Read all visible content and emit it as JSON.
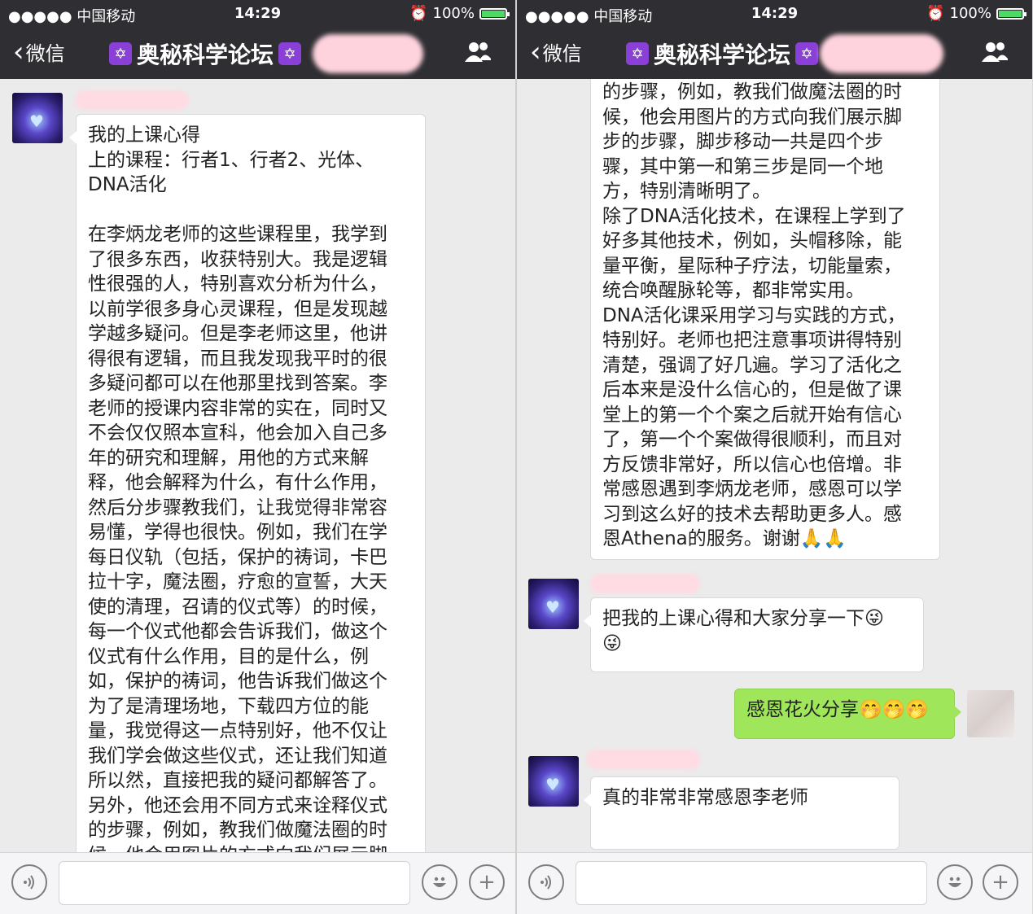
{
  "status": {
    "carrier": "●●●●● 中国移动",
    "time": "14:29",
    "battery": "100%",
    "battery_level": 1.0
  },
  "nav": {
    "back_label": "微信",
    "title": "奥秘科学论坛",
    "title_badge_icon": "star-of-david-icon",
    "members_icon": "people-icon"
  },
  "left_screen": {
    "message": "我的上课心得\n上的课程：行者1、行者2、光体、\nDNA活化\n\n在李炳龙老师的这些课程里，我学到\n了很多东西，收获特别大。我是逻辑\n性很强的人，特别喜欢分析为什么，\n以前学很多身心灵课程，但是发现越\n学越多疑问。但是李老师这里，他讲\n得很有逻辑，而且我发现我平时的很\n多疑问都可以在他那里找到答案。李\n老师的授课内容非常的实在，同时又\n不会仅仅照本宣科，他会加入自己多\n年的研究和理解，用他的方式来解\n释，他会解释为什么，有什么作用，\n然后分步骤教我们，让我觉得非常容\n易懂，学得也很快。例如，我们在学\n每日仪轨（包括，保护的祷词，卡巴\n拉十字，魔法圈，疗愈的宣誓，大天\n使的清理，召请的仪式等）的时候，\n每一个仪式他都会告诉我们，做这个\n仪式有什么作用，目的是什么，例\n如，保护的祷词，他告诉我们做这个\n为了是清理场地，下载四方位的能\n量，我觉得这一点特别好，他不仅让\n我们学会做这些仪式，还让我们知道\n所以然，直接把我的疑问都解答了。\n另外，他还会用不同方式来诠释仪式\n的步骤，例如，教我们做魔法圈的时\n候，他会用图片的方式向我们展示脚"
  },
  "right_screen": {
    "message_continued": "的步骤，例如，教我们做魔法圈的时\n候，他会用图片的方式向我们展示脚\n步的步骤，脚步移动一共是四个步\n骤，其中第一和第三步是同一个地\n方，特别清晰明了。\n除了DNA活化技术，在课程上学到了\n好多其他技术，例如，头帽移除，能\n量平衡，星际种子疗法，切能量索，\n统合唤醒脉轮等，都非常实用。\nDNA活化课采用学习与实践的方式，\n特别好。老师也把注意事项讲得特别\n清楚，强调了好几遍。学习了活化之\n后本来是没什么信心的，但是做了课\n堂上的第一个个案之后就开始有信心\n了，第一个个案做得很顺利，而且对\n方反馈非常好，所以信心也倍增。非\n常感恩遇到李炳龙老师，感恩可以学\n习到这么好的技术去帮助更多人。感\n恩Athena的服务。谢谢🙏🙏",
    "msg_share_request": "把我的上课心得和大家分享一下😜\n😜",
    "msg_reply_me": "感恩花火分享🤭🤭🤭",
    "msg_thanks": "真的非常非常感恩李老师"
  },
  "input": {
    "voice_icon": "voice-icon",
    "emoji_icon": "emoji-icon",
    "plus_icon": "plus-icon"
  },
  "colors": {
    "bar_bg": "#2f2f33",
    "chat_bg": "#ebebeb",
    "bubble_me": "#9fe65b",
    "bubble_other": "#ffffff",
    "badge": "#8a3fd6"
  }
}
